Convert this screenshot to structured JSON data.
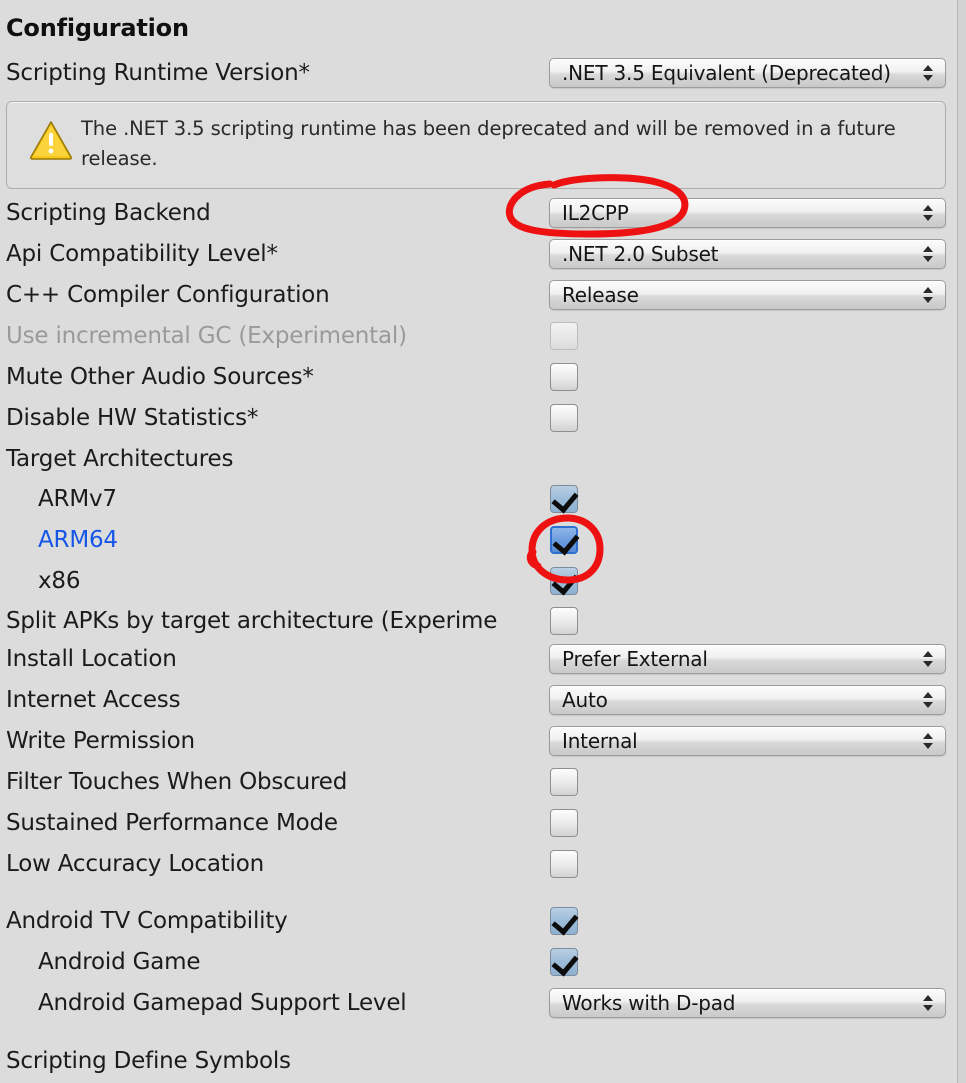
{
  "panel": {
    "title": "Configuration",
    "accent_override_color": "#1555e8",
    "annotation_color": "#ee1111",
    "background_color": "#dcdcdc"
  },
  "warning": {
    "icon": "warning-triangle-icon",
    "text": "The .NET 3.5 scripting runtime has been deprecated and will be removed in a future release."
  },
  "rows": [
    {
      "label": "Scripting Runtime Version*",
      "type": "popup",
      "value": ".NET 3.5 Equivalent (Deprecated)"
    },
    {
      "label": "Scripting Backend",
      "type": "popup",
      "value": "IL2CPP",
      "annotated": true
    },
    {
      "label": "Api Compatibility Level*",
      "type": "popup",
      "value": ".NET 2.0 Subset"
    },
    {
      "label": "C++ Compiler Configuration",
      "type": "popup",
      "value": "Release"
    },
    {
      "label": "Use incremental GC (Experimental)",
      "type": "checkbox",
      "checked": false,
      "disabled": true
    },
    {
      "label": "Mute Other Audio Sources*",
      "type": "checkbox",
      "checked": false
    },
    {
      "label": "Disable HW Statistics*",
      "type": "checkbox",
      "checked": false
    },
    {
      "label": "Target Architectures",
      "type": "header"
    },
    {
      "label": "ARMv7",
      "type": "checkbox",
      "checked": true,
      "indent": true
    },
    {
      "label": "ARM64",
      "type": "checkbox",
      "checked": true,
      "indent": true,
      "override": true,
      "focused": true,
      "annotated": true
    },
    {
      "label": "x86",
      "type": "checkbox",
      "checked": true,
      "indent": true
    },
    {
      "label": "Split APKs by target architecture (Experime",
      "type": "checkbox",
      "checked": false,
      "clipped": true
    },
    {
      "label": "Install Location",
      "type": "popup",
      "value": "Prefer External"
    },
    {
      "label": "Internet Access",
      "type": "popup",
      "value": "Auto"
    },
    {
      "label": "Write Permission",
      "type": "popup",
      "value": "Internal"
    },
    {
      "label": "Filter Touches When Obscured",
      "type": "checkbox",
      "checked": false
    },
    {
      "label": "Sustained Performance Mode",
      "type": "checkbox",
      "checked": false
    },
    {
      "label": "Low Accuracy Location",
      "type": "checkbox",
      "checked": false
    },
    {
      "label": "Android TV Compatibility",
      "type": "checkbox",
      "checked": true
    },
    {
      "label": "Android Game",
      "type": "checkbox",
      "checked": true,
      "indent": true
    },
    {
      "label": "Android Gamepad Support Level",
      "type": "popup",
      "value": "Works with D-pad",
      "indent": true
    },
    {
      "label": "Scripting Define Symbols",
      "type": "header"
    }
  ]
}
